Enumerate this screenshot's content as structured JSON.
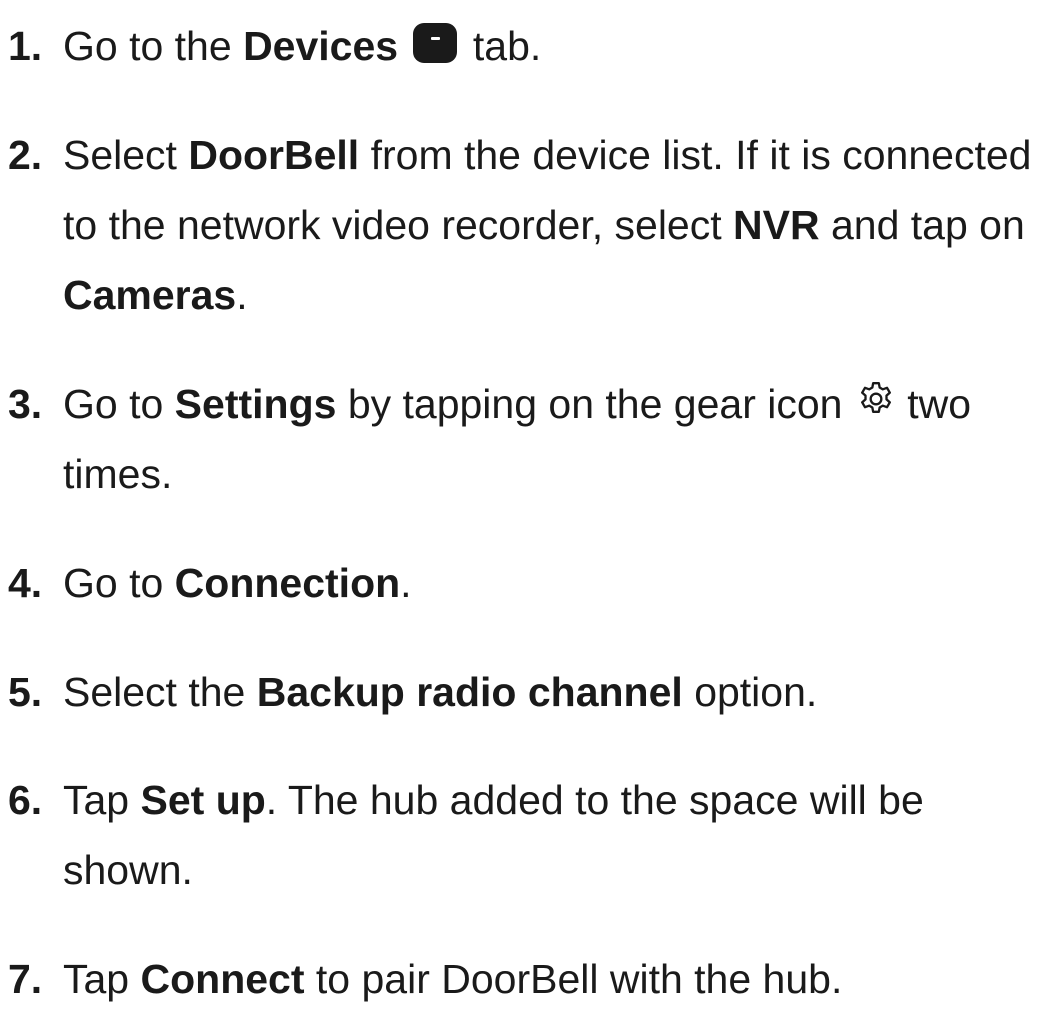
{
  "steps": [
    {
      "number": "1.",
      "parts": [
        "Go to the ",
        "Devices",
        " tab."
      ],
      "icon": "devices-tab-icon"
    },
    {
      "number": "2.",
      "parts": [
        "Select ",
        "DoorBell",
        " from the device list. If it is connected to the network video recorder, select ",
        "NVR",
        " and tap on ",
        "Cameras",
        "."
      ]
    },
    {
      "number": "3.",
      "parts": [
        "Go to ",
        "Settings",
        " by tapping on the gear icon",
        " two times."
      ],
      "icon": "gear-icon"
    },
    {
      "number": "4.",
      "parts": [
        "Go to ",
        "Connection",
        "."
      ]
    },
    {
      "number": "5.",
      "parts": [
        "Select the ",
        "Backup radio channel",
        " option."
      ]
    },
    {
      "number": "6.",
      "parts": [
        "Tap ",
        "Set up",
        ". The hub added to the space will be shown."
      ]
    },
    {
      "number": "7.",
      "parts": [
        "Tap ",
        "Connect",
        " to pair DoorBell with the hub."
      ]
    }
  ],
  "colors": {
    "text": "#1a1a1a",
    "background": "#ffffff"
  }
}
